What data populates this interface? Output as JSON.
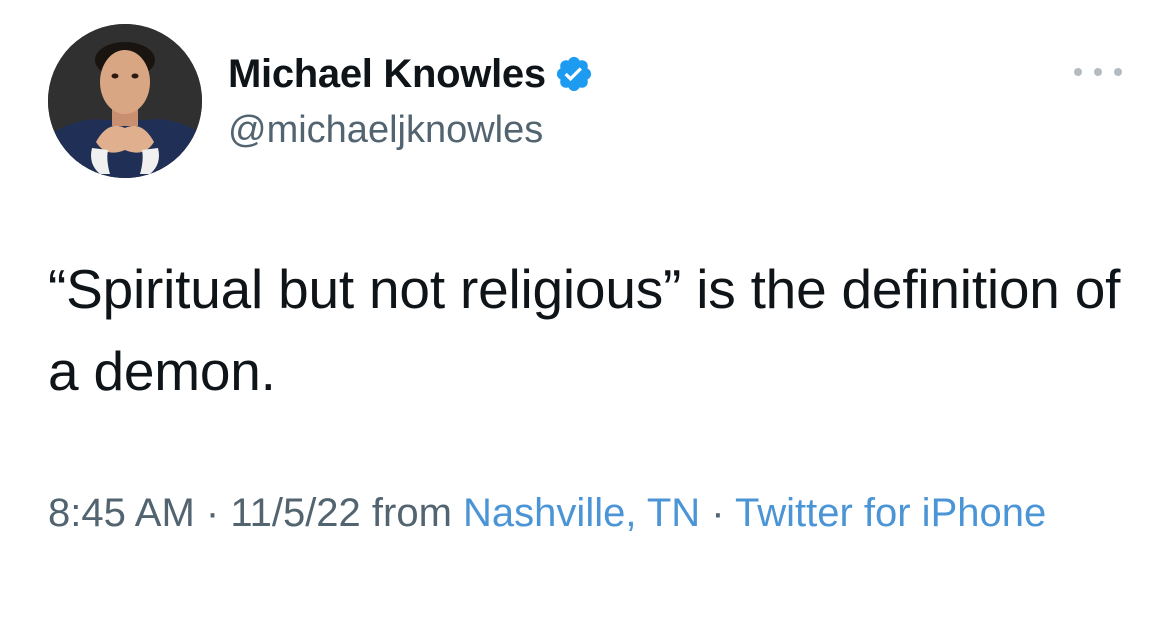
{
  "tweet": {
    "author": {
      "name": "Michael Knowles",
      "handle": "@michaeljknowles",
      "verified": true
    },
    "text": "“Spiritual but not religious” is the definition of a demon.",
    "meta": {
      "time": "8:45 AM",
      "separator1": " · ",
      "date": "11/5/22",
      "from_label": " from ",
      "location": "Nashville, TN",
      "separator2": " · ",
      "source": "Twitter for iPhone"
    }
  },
  "icons": {
    "verified": "verified-badge-icon",
    "more": "more-options-icon"
  },
  "colors": {
    "verified": "#1d9bf0",
    "link": "#4b95d6",
    "secondary_text": "#536471",
    "primary_text": "#0f1419"
  }
}
